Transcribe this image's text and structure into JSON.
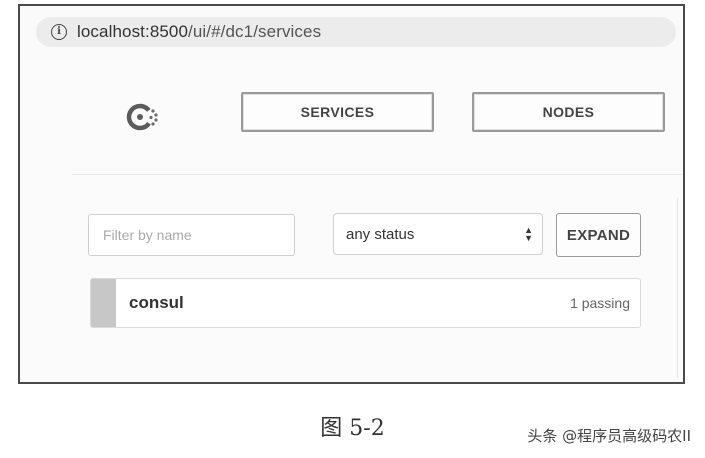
{
  "browser": {
    "url_host": "localhost:8500",
    "url_path": "/ui/#/dc1/services",
    "info_glyph": "i"
  },
  "nav": {
    "logo": "consul-logo-icon",
    "services_label": "SERVICES",
    "nodes_label": "NODES"
  },
  "filters": {
    "name_placeholder": "Filter by name",
    "name_value": "",
    "status_selected": "any status",
    "expand_label": "EXPAND"
  },
  "services": [
    {
      "name": "consul",
      "status": "1 passing",
      "status_color": "#c7c7c7"
    }
  ],
  "caption": "图 5-2",
  "watermark": "头条 @程序员高级码农II"
}
